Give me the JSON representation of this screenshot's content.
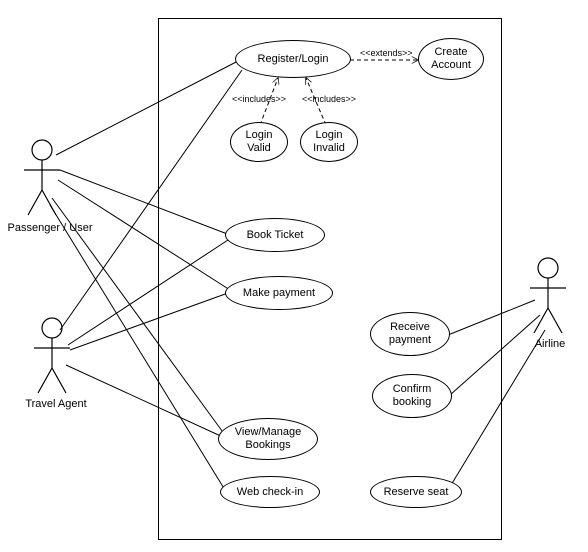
{
  "chart_data": {
    "type": "use-case-diagram",
    "actors": [
      "Passenger / User",
      "Travel Agent",
      "Airline"
    ],
    "use_cases": [
      "Register/Login",
      "Create Account",
      "Login Valid",
      "Login Invalid",
      "Book Ticket",
      "Make payment",
      "Receive payment",
      "Confirm booking",
      "View/Manage Bookings",
      "Web check-in",
      "Reserve seat"
    ],
    "associations": [
      {
        "actor": "Passenger / User",
        "use_case": "Register/Login"
      },
      {
        "actor": "Passenger / User",
        "use_case": "Book Ticket"
      },
      {
        "actor": "Passenger / User",
        "use_case": "Make payment"
      },
      {
        "actor": "Passenger / User",
        "use_case": "View/Manage Bookings"
      },
      {
        "actor": "Passenger / User",
        "use_case": "Web check-in"
      },
      {
        "actor": "Travel Agent",
        "use_case": "Register/Login"
      },
      {
        "actor": "Travel Agent",
        "use_case": "Book Ticket"
      },
      {
        "actor": "Travel Agent",
        "use_case": "Make payment"
      },
      {
        "actor": "Travel Agent",
        "use_case": "View/Manage Bookings"
      },
      {
        "actor": "Airline",
        "use_case": "Receive payment"
      },
      {
        "actor": "Airline",
        "use_case": "Confirm booking"
      },
      {
        "actor": "Airline",
        "use_case": "Reserve seat"
      }
    ],
    "relationships": [
      {
        "from": "Login Valid",
        "to": "Register/Login",
        "type": "include"
      },
      {
        "from": "Login Invalid",
        "to": "Register/Login",
        "type": "include"
      },
      {
        "from": "Register/Login",
        "to": "Create Account",
        "type": "extend"
      }
    ]
  },
  "actors": {
    "passenger": "Passenger / User",
    "travelAgent": "Travel Agent",
    "airline": "Airline"
  },
  "usecases": {
    "registerLogin": "Register/Login",
    "createAccount": "Create\nAccount",
    "loginValid": "Login\nValid",
    "loginInvalid": "Login\nInvalid",
    "bookTicket": "Book Ticket",
    "makePayment": "Make payment",
    "receivePayment": "Receive\npayment",
    "confirmBooking": "Confirm\nbooking",
    "viewManage": "View/Manage\nBookings",
    "webCheckin": "Web check-in",
    "reserveSeat": "Reserve seat"
  },
  "stereotypes": {
    "extends": "<<extends>>",
    "includes1": "<<includes>>",
    "includes2": "<<includes>>"
  }
}
